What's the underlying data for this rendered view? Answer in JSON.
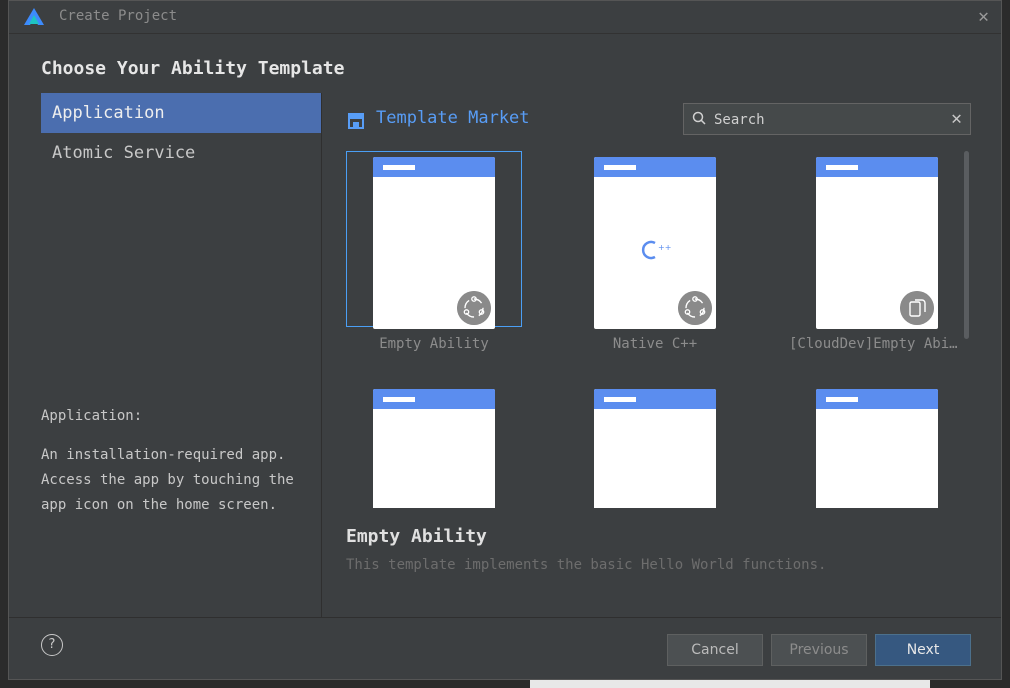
{
  "window": {
    "title": "Create Project",
    "close_icon": "close-icon"
  },
  "heading": "Choose Your Ability Template",
  "sidebar": {
    "items": [
      {
        "label": "Application",
        "selected": true
      },
      {
        "label": "Atomic Service",
        "selected": false
      }
    ]
  },
  "description": {
    "title": "Application:",
    "body": "An installation-required app. Access the app by touching the app icon on the home screen."
  },
  "market": {
    "label": "Template Market",
    "icon": "store-icon"
  },
  "search": {
    "placeholder": "Search",
    "value": ""
  },
  "templates": [
    {
      "label": "Empty Ability",
      "selected": true,
      "badge_icon": "ability-icon"
    },
    {
      "label": "Native C++",
      "selected": false,
      "badge_icon": "ability-icon",
      "center_icon": "cpp-icon"
    },
    {
      "label": "[CloudDev]Empty Ability",
      "selected": false,
      "badge_icon": "cloud-device-icon"
    },
    {
      "label": "",
      "selected": false
    },
    {
      "label": "",
      "selected": false
    },
    {
      "label": "",
      "selected": false
    }
  ],
  "detail": {
    "title": "Empty Ability",
    "description": "This template implements the basic Hello World functions."
  },
  "footer": {
    "help_label": "?",
    "cancel_label": "Cancel",
    "previous_label": "Previous",
    "next_label": "Next"
  },
  "colors": {
    "accent": "#4b6eaf",
    "link": "#589df6",
    "primary_button": "#365880",
    "card_bar": "#5b8def"
  }
}
